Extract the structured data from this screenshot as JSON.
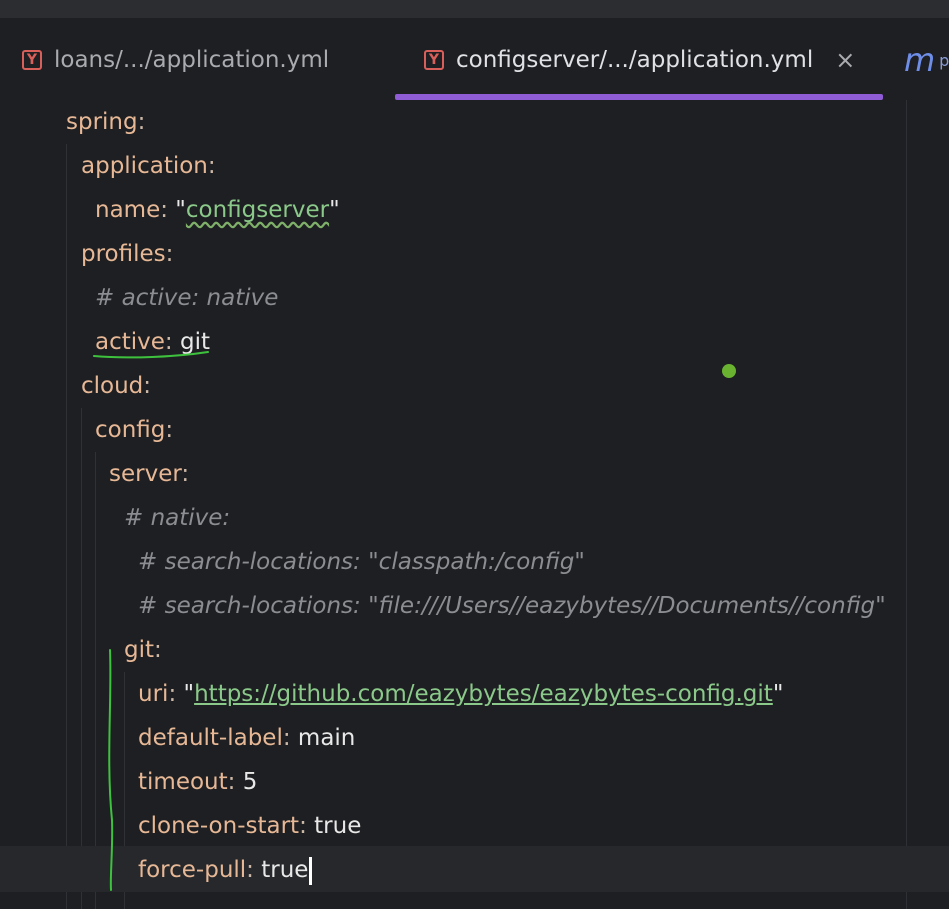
{
  "tabs": [
    {
      "label": "loans/.../application.yml",
      "icon": "yaml-icon",
      "active": false
    },
    {
      "label": "configserver/.../application.yml",
      "icon": "yaml-icon",
      "active": true,
      "close": "×"
    },
    {
      "label": "m",
      "suffix": "p",
      "icon": "maven-icon",
      "active": false
    }
  ],
  "tab_icon_glyph": "Y",
  "colors": {
    "key": "#e7b896",
    "string": "#8bc98a",
    "comment": "#8b8d92",
    "accent": "#8f5cd6",
    "annotation": "#3ec23e"
  },
  "code": {
    "l1_key": "spring",
    "l2_key": "application",
    "l3_key": "name",
    "l3_val": "configserver",
    "l4_key": "profiles",
    "l5_comment": "# active: native",
    "l6_key": "active",
    "l6_val": "git",
    "l7_key": "cloud",
    "l8_key": "config",
    "l9_key": "server",
    "l10_comment": "# native:",
    "l11_comment": "# search-locations: \"classpath:/config\"",
    "l12_comment": "# search-locations: \"file:///Users//eazybytes//Documents//config\"",
    "l13_key": "git",
    "l14_key": "uri",
    "l14_val": "https://github.com/eazybytes/eazybytes-config.git",
    "l15_key": "default-label",
    "l15_val": "main",
    "l16_key": "timeout",
    "l16_val": "5",
    "l17_key": "clone-on-start",
    "l17_val": "true",
    "l18_key": "force-pull",
    "l18_val": "true"
  },
  "punct": {
    "colon": ":",
    "quote": "\""
  }
}
